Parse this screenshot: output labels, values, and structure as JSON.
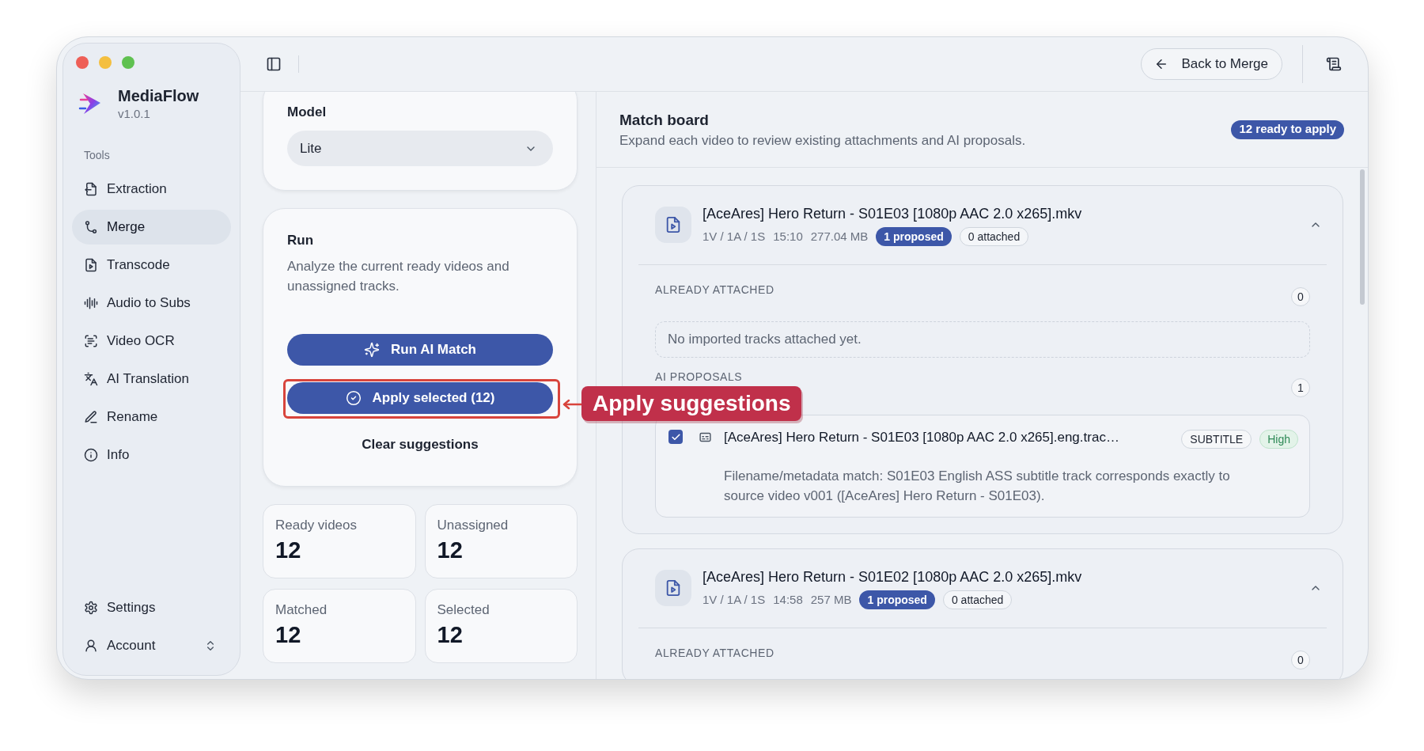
{
  "app": {
    "name": "MediaFlow",
    "version": "v1.0.1"
  },
  "sidebar": {
    "section_label": "Tools",
    "items": [
      {
        "label": "Extraction",
        "selected": false
      },
      {
        "label": "Merge",
        "selected": true
      },
      {
        "label": "Transcode",
        "selected": false
      },
      {
        "label": "Audio to Subs",
        "selected": false
      },
      {
        "label": "Video OCR",
        "selected": false
      },
      {
        "label": "AI Translation",
        "selected": false
      },
      {
        "label": "Rename",
        "selected": false
      },
      {
        "label": "Info",
        "selected": false
      }
    ],
    "footer": [
      {
        "label": "Settings",
        "kind": "link"
      },
      {
        "label": "Account",
        "kind": "menu"
      }
    ]
  },
  "toolbar": {
    "back_button": "Back to Merge"
  },
  "model_card": {
    "label": "Model",
    "value": "Lite"
  },
  "run_card": {
    "title": "Run",
    "description": "Analyze the current ready videos and unassigned tracks.",
    "buttons": [
      {
        "label": "Run AI Match",
        "kind": "primary",
        "highlighted": false
      },
      {
        "label": "Apply selected (12)",
        "kind": "primary",
        "highlighted": true
      },
      {
        "label": "Clear suggestions",
        "kind": "text",
        "highlighted": false
      }
    ]
  },
  "stats": [
    {
      "label": "Ready videos",
      "value": "12"
    },
    {
      "label": "Unassigned",
      "value": "12"
    },
    {
      "label": "Matched",
      "value": "12"
    },
    {
      "label": "Selected",
      "value": "12"
    }
  ],
  "match_board": {
    "title": "Match board",
    "subtitle": "Expand each video to review existing attachments and AI proposals.",
    "badge": "12 ready to apply",
    "videos": [
      {
        "title": "[AceAres] Hero Return - S01E03 [1080p AAC 2.0 x265].mkv",
        "tracks": "1V / 1A / 1S",
        "duration": "15:10",
        "size": "277.04 MB",
        "proposed": "1 proposed",
        "attached": "0 attached",
        "expanded": true,
        "already_attached": {
          "label": "ALREADY ATTACHED",
          "count": "0",
          "empty_text": "No imported tracks attached yet."
        },
        "ai_proposals": {
          "label": "AI PROPOSALS",
          "count": "1",
          "items": [
            {
              "checked": true,
              "title": "[AceAres] Hero Return - S01E03 [1080p AAC 2.0 x265].eng.trac…",
              "type": "SUBTITLE",
              "confidence": "High",
              "reason": "Filename/metadata match: S01E03 English ASS subtitle track corresponds exactly to source video v001 ([AceAres] Hero Return - S01E03)."
            }
          ]
        }
      },
      {
        "title": "[AceAres] Hero Return - S01E02 [1080p AAC 2.0 x265].mkv",
        "tracks": "1V / 1A / 1S",
        "duration": "14:58",
        "size": "257 MB",
        "proposed": "1 proposed",
        "attached": "0 attached",
        "expanded": true,
        "already_attached": {
          "label": "ALREADY ATTACHED",
          "count": "0"
        }
      }
    ]
  },
  "annotation": {
    "label": "Apply suggestions"
  }
}
